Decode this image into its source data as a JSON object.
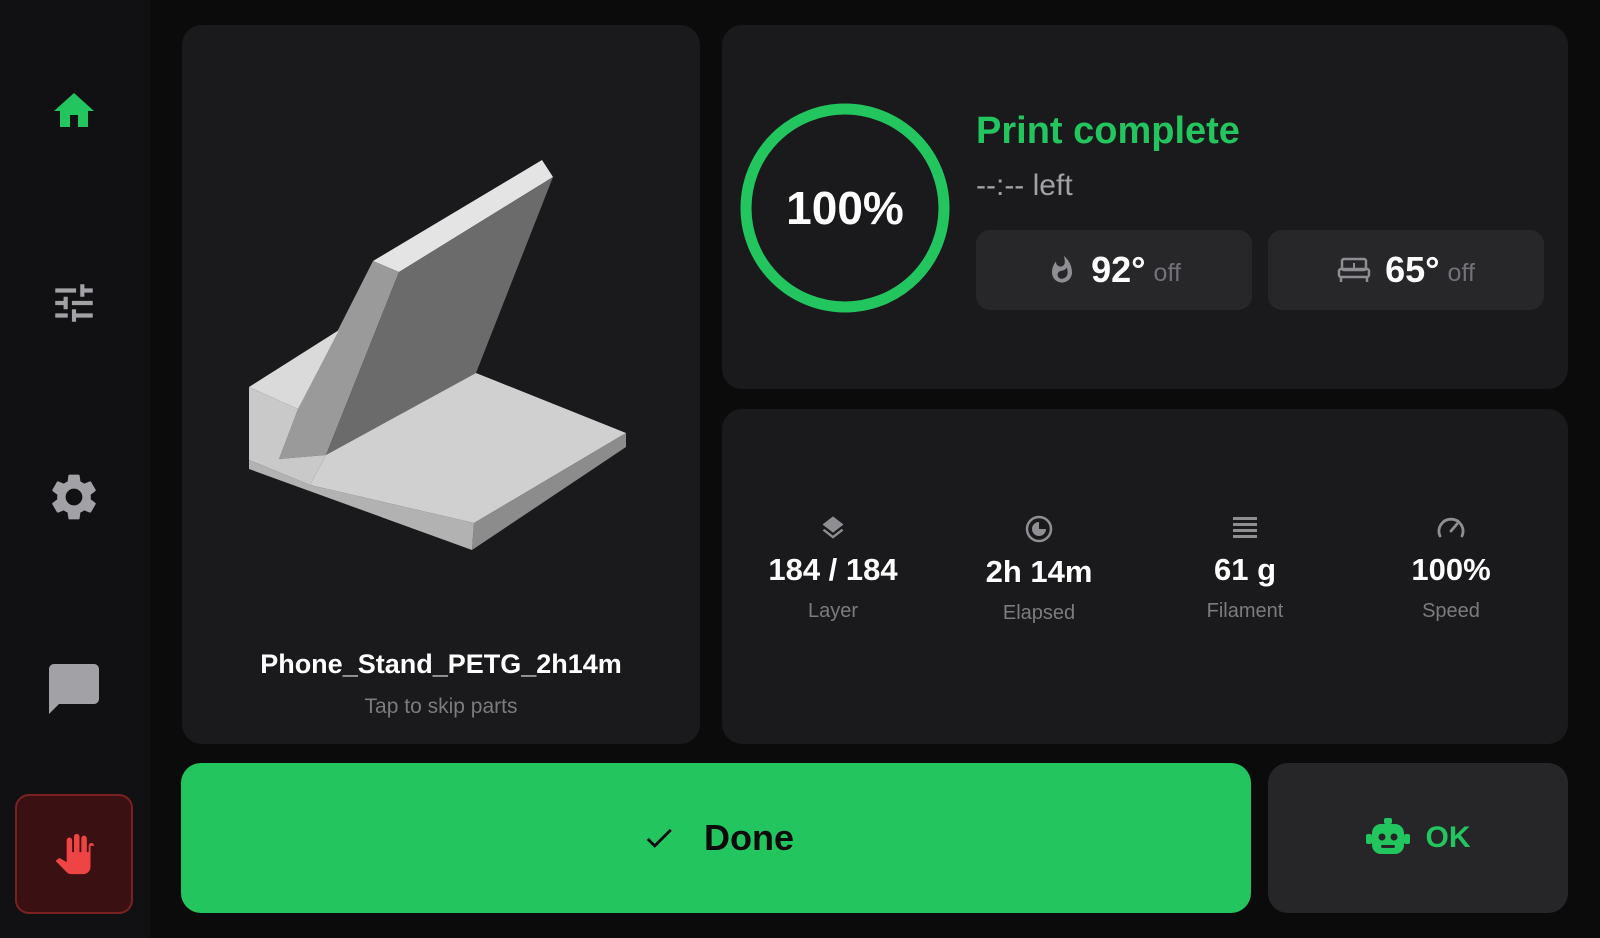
{
  "nav": {
    "items": [
      {
        "name": "home",
        "icon": "home-icon",
        "active": true
      },
      {
        "name": "tune",
        "icon": "sliders-icon",
        "active": false
      },
      {
        "name": "settings",
        "icon": "gear-icon",
        "active": false
      },
      {
        "name": "console",
        "icon": "chat-icon",
        "active": false
      }
    ],
    "estop_icon": "hand-stop-icon"
  },
  "job": {
    "file_name": "Phone_Stand_PETG_2h14m",
    "skip_hint": "Tap to skip parts",
    "thumbnail_icon": "model-preview"
  },
  "status": {
    "progress_percent": 100,
    "progress_label": "100%",
    "title": "Print complete",
    "time_left": "--:-- left",
    "nozzle": {
      "icon": "flame-icon",
      "temp": "92°",
      "state": "off"
    },
    "bed": {
      "icon": "bed-icon",
      "temp": "65°",
      "state": "off"
    }
  },
  "stats": {
    "layer": {
      "icon": "layers-icon",
      "value": "184 / 184",
      "label": "Layer"
    },
    "elapsed": {
      "icon": "clock-icon",
      "value": "2h 14m",
      "label": "Elapsed"
    },
    "filament": {
      "icon": "filament-icon",
      "value": "61 g",
      "label": "Filament"
    },
    "speed": {
      "icon": "gauge-icon",
      "value": "100%",
      "label": "Speed"
    }
  },
  "actions": {
    "done_label": "Done",
    "done_icon": "check-icon",
    "ok_label": "OK",
    "ok_icon": "robot-icon"
  },
  "colors": {
    "accent": "#22c55e",
    "background": "#0b0b0c",
    "card": "#1a1a1c",
    "estop": "#ef4444"
  }
}
